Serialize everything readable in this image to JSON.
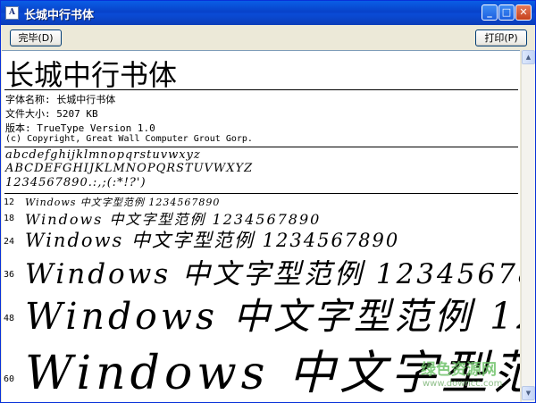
{
  "window": {
    "title": "长城中行书体",
    "app_icon": "font-file-icon",
    "minimize_glyph": "_",
    "maximize_glyph": "□",
    "close_glyph": "✕"
  },
  "toolbar": {
    "done_label": "完毕(D)",
    "print_label": "打印(P)"
  },
  "font": {
    "display_name": "长城中行书体",
    "name_line": "字体名称: 长城中行书体",
    "size_line": "文件大小: 5207 KB",
    "version_line": "版本: TrueType Version 1.0",
    "copyright_line": "(c) Copyright, Great Wall Computer Grout Gorp."
  },
  "charset": {
    "lowercase": "abcdefghijklmnopqrstuvwxyz",
    "uppercase": "ABCDEFGHIJKLMNOPQRSTUVWXYZ",
    "digits": "1234567890.:,;(:*!?')"
  },
  "sample_text": "Windows 中文字型范例 1234567890",
  "sizes": [
    {
      "label": "12"
    },
    {
      "label": "18"
    },
    {
      "label": "24"
    },
    {
      "label": "36"
    },
    {
      "label": "48"
    },
    {
      "label": "60"
    }
  ],
  "scrollbar": {
    "up_glyph": "▲",
    "down_glyph": "▼"
  },
  "watermark": {
    "text": "绿色资源网",
    "url": "www.downcc.com"
  }
}
